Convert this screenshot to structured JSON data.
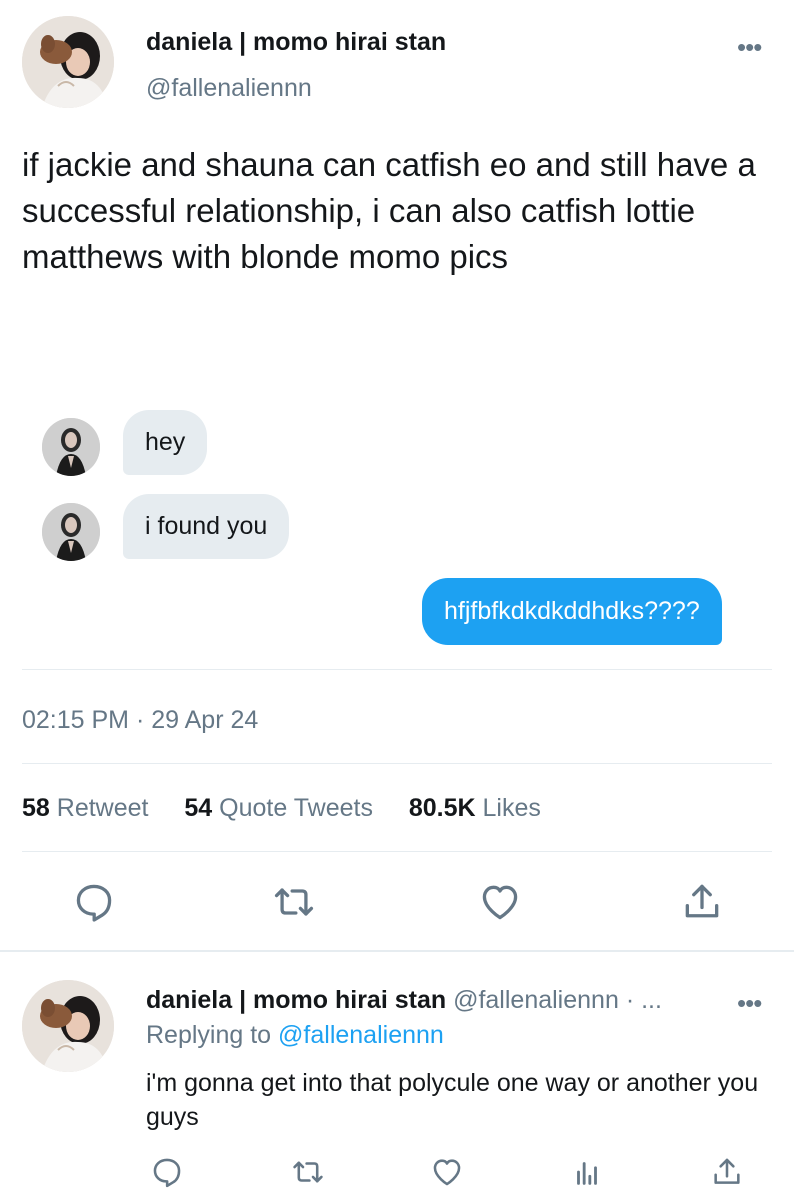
{
  "tweet": {
    "display_name": "daniela | momo hirai stan",
    "handle": "@fallenaliennn",
    "more_icon": "more-dots-icon",
    "text": "if jackie and shauna can catfish eo and still have a successful relationship, i can also catfish lottie matthews with blonde momo pics",
    "messages": [
      {
        "direction": "incoming",
        "text": "hey"
      },
      {
        "direction": "incoming",
        "text": "i found you"
      },
      {
        "direction": "outgoing",
        "text": "hfjfbfkdkdkddhdks????"
      }
    ],
    "time": "02:15 PM",
    "separator": "·",
    "date": "29 Apr 24",
    "stats": {
      "retweets_count": "58",
      "retweets_label": "Retweet",
      "quotes_count": "54",
      "quotes_label": "Quote Tweets",
      "likes_count": "80.5K",
      "likes_label": "Likes"
    },
    "actions": [
      "reply-icon",
      "retweet-icon",
      "like-icon",
      "share-icon"
    ]
  },
  "reply": {
    "display_name": "daniela | momo hirai stan",
    "handle": "@fallenaliennn",
    "handle_suffix": "· ...",
    "replying_prefix": "Replying to",
    "replying_to": "@fallenaliennn",
    "text": "i'm gonna get into that polycule one way or another you guys",
    "actions": [
      "reply-icon",
      "retweet-icon",
      "like-icon",
      "analytics-icon",
      "share-icon"
    ]
  },
  "colors": {
    "accent": "#1da1f2",
    "text": "#14171a",
    "secondary": "#657786",
    "bubble_in": "#e6ecf0"
  }
}
